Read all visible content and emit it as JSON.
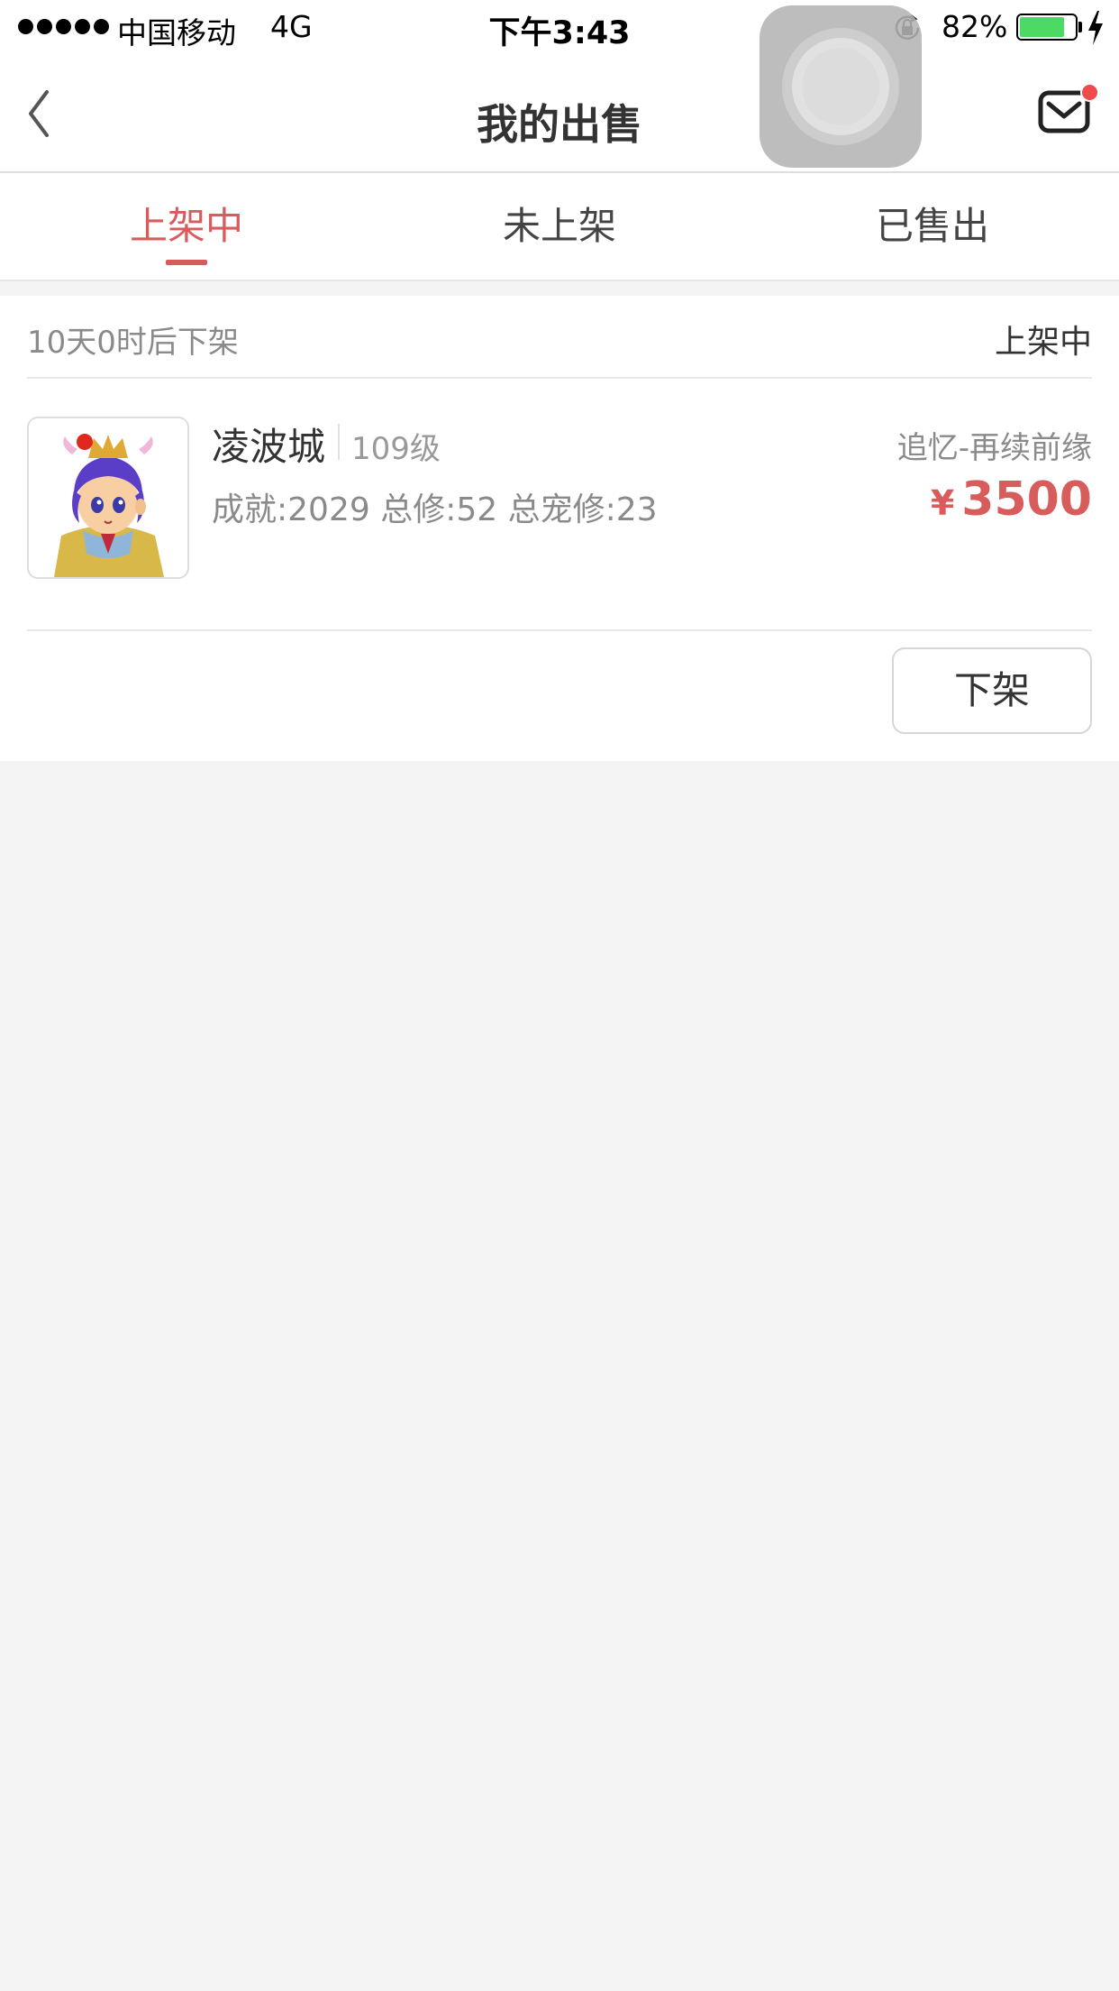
{
  "status_bar": {
    "carrier": "中国移动",
    "network": "4G",
    "time": "下午3:43",
    "battery_percent": "82%",
    "battery_level": 0.82,
    "icons": [
      "signal-dots-icon",
      "orientation-lock-icon",
      "battery-icon",
      "charging-bolt-icon"
    ]
  },
  "nav": {
    "title": "我的出售",
    "back_icon": "chevron-left-icon",
    "mail_icon": "mail-icon",
    "badge_color": "#ef4b4b"
  },
  "tabs": [
    {
      "label": "上架中",
      "active": true
    },
    {
      "label": "未上架",
      "active": false
    },
    {
      "label": "已售出",
      "active": false
    }
  ],
  "listing": {
    "expiry": "10天0时后下架",
    "status": "上架中",
    "character_name": "凌波城",
    "level": "109级",
    "server": "追忆-再续前缘",
    "stats": "成就:2029 总修:52 总宠修:23",
    "price_symbol": "¥",
    "price": "3500",
    "action_label": "下架"
  },
  "colors": {
    "accent": "#d85c5c",
    "background": "#f4f4f4",
    "battery_green": "#4cd964"
  }
}
